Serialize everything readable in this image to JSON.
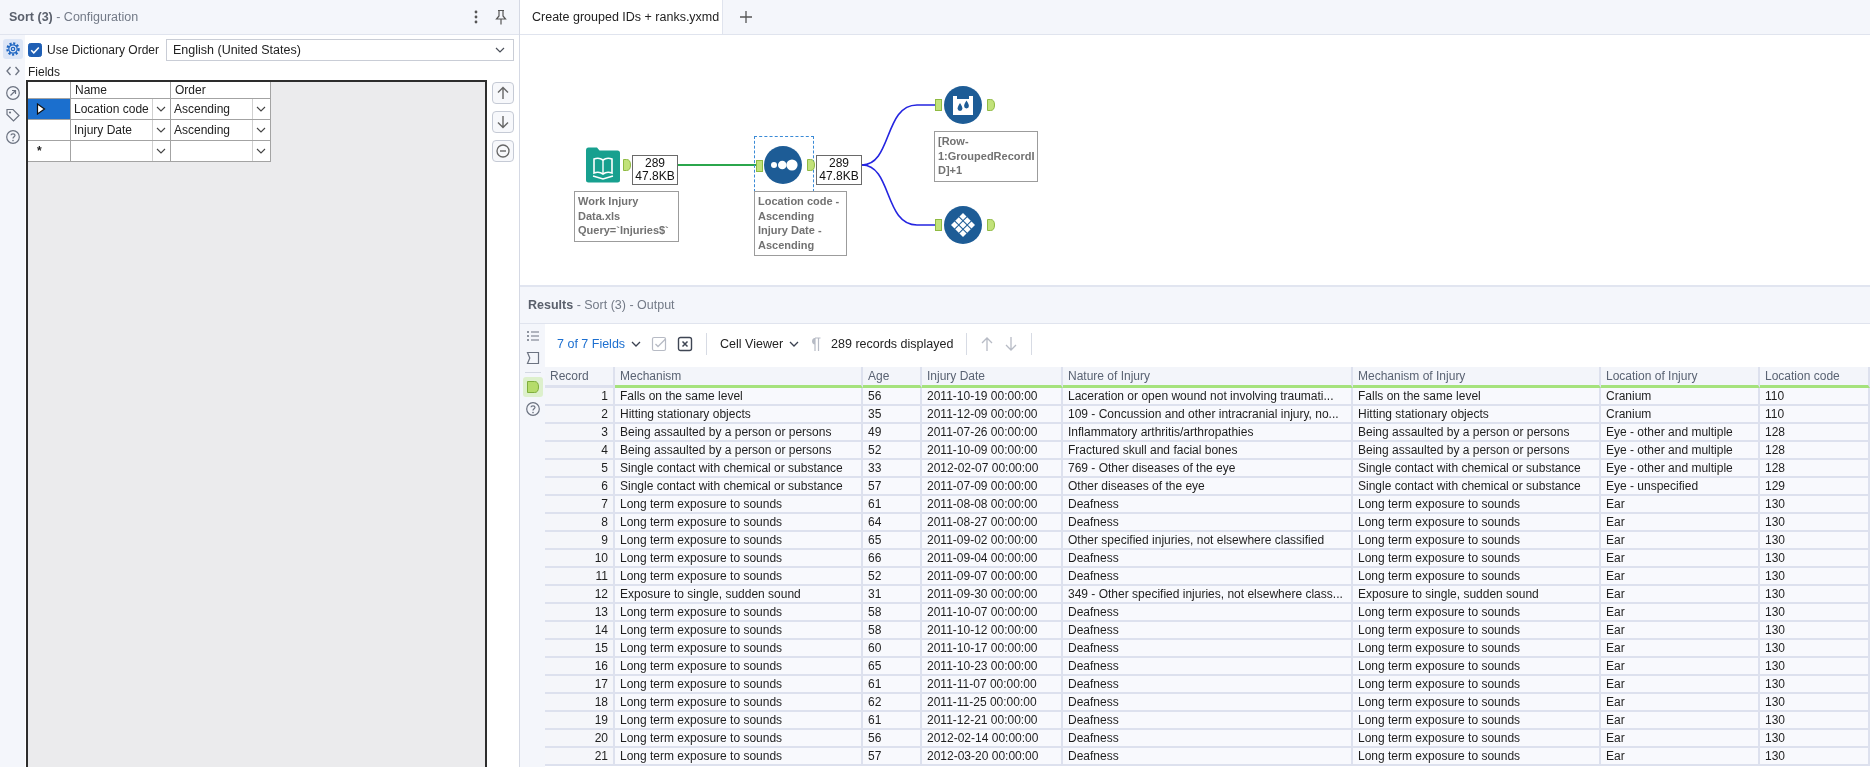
{
  "config": {
    "title": "**Sort (3)** - Configuration",
    "side_tabs": [
      {
        "selected": true
      },
      {
        "selected": false
      },
      {
        "selected": false
      },
      {
        "selected": false
      },
      {
        "selected": false
      }
    ],
    "dictionary_order": {
      "label": "Use Dictionary Order",
      "checked": true
    },
    "language": {
      "value": "English (United States)"
    },
    "fields_label": "Fields",
    "sort_fields": {
      "columns": [
        "Name",
        "Order"
      ],
      "rows": [
        {
          "name": "Location code",
          "order": "Ascending",
          "selected": true
        },
        {
          "name": "Injury Date",
          "order": "Ascending",
          "selected": false
        }
      ],
      "new_row_marker": "*"
    }
  },
  "editor": {
    "tabs": [
      {
        "title": "Create grouped IDs + ranks.yxmd",
        "selected": true
      }
    ]
  },
  "workflow": {
    "nodes": [
      {
        "kind": "book",
        "selected": false,
        "count": "289",
        "size": "47.8KB",
        "annotation": "Work Injury Data.xls\nQuery=`Injuries$`"
      },
      {
        "kind": "dots",
        "selected": true,
        "count": "289",
        "size": "47.8KB",
        "annotation": "Location code - Ascending\nInjury Date - Ascending"
      },
      {
        "kind": "droplets",
        "selected": false,
        "annotation": "[Row-1:GroupedRecordID]+1"
      },
      {
        "kind": "diamonds",
        "selected": false
      }
    ],
    "connections": [
      {
        "color": "#2ba64c"
      },
      {
        "color": "#2424e0"
      },
      {
        "color": "#2424e0"
      }
    ]
  },
  "results": {
    "title": "**Results** - Sort (3) - Output",
    "side_tabs": [
      {
        "selected": false
      },
      {
        "selected": false
      },
      {
        "selected": true
      },
      {
        "selected": false
      }
    ],
    "toolbar": {
      "fields_menu": "7 of 7 Fields",
      "icon_buttons": [
        {
          "disabled": true
        },
        {
          "disabled": false
        }
      ],
      "viewer_menu": "Cell Viewer",
      "pilcrow_button": {
        "disabled": true
      },
      "record_count": "289 records displayed",
      "nav_buttons": [
        {
          "disabled": true
        },
        {
          "disabled": true
        }
      ]
    },
    "table": {
      "columns": [
        "Record",
        "Mechanism",
        "Age",
        "Injury Date",
        "Nature of Injury",
        "Mechanism of Injury",
        "Location of Injury",
        "Location code"
      ],
      "rows": [
        [
          "1",
          "Falls on the same level",
          "56",
          "2011-10-19 00:00:00",
          "Laceration or open wound not involving traumati...",
          "Falls on the same level",
          "Cranium",
          "110"
        ],
        [
          "2",
          "Hitting stationary objects",
          "35",
          "2011-12-09 00:00:00",
          "109 - Concussion and other intracranial injury, no...",
          "Hitting stationary objects",
          "Cranium",
          "110"
        ],
        [
          "3",
          "Being assaulted by a person or persons",
          "49",
          "2011-07-26 00:00:00",
          "Inflammatory arthritis/arthropathies",
          "Being assaulted by a person or persons",
          "Eye - other and multiple",
          "128"
        ],
        [
          "4",
          "Being assaulted by a person or persons",
          "52",
          "2011-10-09 00:00:00",
          "Fractured skull and facial bones",
          "Being assaulted by a person or persons",
          "Eye - other and multiple",
          "128"
        ],
        [
          "5",
          "Single contact with chemical or substance",
          "33",
          "2012-02-07 00:00:00",
          "769 - Other diseases of the eye",
          "Single contact with chemical or substance",
          "Eye - other and multiple",
          "128"
        ],
        [
          "6",
          "Single contact with chemical or substance",
          "57",
          "2011-07-09 00:00:00",
          "Other diseases of the eye",
          "Single contact with chemical or substance",
          "Eye - unspecified",
          "129"
        ],
        [
          "7",
          "Long term exposure to sounds",
          "61",
          "2011-08-08 00:00:00",
          "Deafness",
          "Long term exposure to sounds",
          "Ear",
          "130"
        ],
        [
          "8",
          "Long term exposure to sounds",
          "64",
          "2011-08-27 00:00:00",
          "Deafness",
          "Long term exposure to sounds",
          "Ear",
          "130"
        ],
        [
          "9",
          "Long term exposure to sounds",
          "65",
          "2011-09-02 00:00:00",
          "Other specified injuries, not elsewhere classified",
          "Long term exposure to sounds",
          "Ear",
          "130"
        ],
        [
          "10",
          "Long term exposure to sounds",
          "66",
          "2011-09-04 00:00:00",
          "Deafness",
          "Long term exposure to sounds",
          "Ear",
          "130"
        ],
        [
          "11",
          "Long term exposure to sounds",
          "52",
          "2011-09-07 00:00:00",
          "Deafness",
          "Long term exposure to sounds",
          "Ear",
          "130"
        ],
        [
          "12",
          "Exposure to single, sudden sound",
          "31",
          "2011-09-30 00:00:00",
          "349 - Other specified injuries, not elsewhere class...",
          "Exposure to single, sudden sound",
          "Ear",
          "130"
        ],
        [
          "13",
          "Long term exposure to sounds",
          "58",
          "2011-10-07 00:00:00",
          "Deafness",
          "Long term exposure to sounds",
          "Ear",
          "130"
        ],
        [
          "14",
          "Long term exposure to sounds",
          "58",
          "2011-10-12 00:00:00",
          "Deafness",
          "Long term exposure to sounds",
          "Ear",
          "130"
        ],
        [
          "15",
          "Long term exposure to sounds",
          "60",
          "2011-10-17 00:00:00",
          "Deafness",
          "Long term exposure to sounds",
          "Ear",
          "130"
        ],
        [
          "16",
          "Long term exposure to sounds",
          "65",
          "2011-10-23 00:00:00",
          "Deafness",
          "Long term exposure to sounds",
          "Ear",
          "130"
        ],
        [
          "17",
          "Long term exposure to sounds",
          "61",
          "2011-11-07 00:00:00",
          "Deafness",
          "Long term exposure to sounds",
          "Ear",
          "130"
        ],
        [
          "18",
          "Long term exposure to sounds",
          "62",
          "2011-11-25 00:00:00",
          "Deafness",
          "Long term exposure to sounds",
          "Ear",
          "130"
        ],
        [
          "19",
          "Long term exposure to sounds",
          "61",
          "2011-12-21 00:00:00",
          "Deafness",
          "Long term exposure to sounds",
          "Ear",
          "130"
        ],
        [
          "20",
          "Long term exposure to sounds",
          "56",
          "2012-02-14 00:00:00",
          "Deafness",
          "Long term exposure to sounds",
          "Ear",
          "130"
        ],
        [
          "21",
          "Long term exposure to sounds",
          "57",
          "2012-03-20 00:00:00",
          "Deafness",
          "Long term exposure to sounds",
          "Ear",
          "130"
        ]
      ]
    }
  }
}
